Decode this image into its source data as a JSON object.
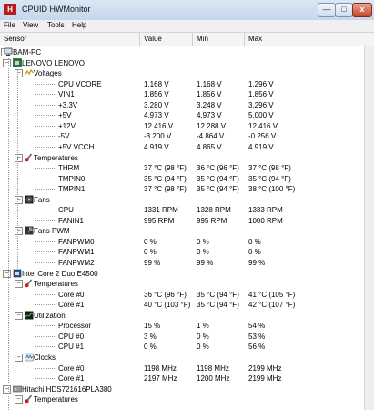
{
  "window": {
    "title": "CPUID HWMonitor",
    "icon_letter": "H",
    "accent": "#b71c1c",
    "minimize_glyph": "—",
    "maximize_glyph": "□",
    "close_glyph": "x"
  },
  "menu": [
    "File",
    "View",
    "Tools",
    "Help"
  ],
  "columns": {
    "sensor": "Sensor",
    "value": "Value",
    "min": "Min",
    "max": "Max"
  },
  "rows": [
    {
      "label": "BAM-PC",
      "icon": "computer-icon",
      "level": 0,
      "value": "",
      "min": "",
      "max": ""
    },
    {
      "label": "LENOVO LENOVO",
      "icon": "motherboard-icon",
      "level": 1,
      "value": "",
      "min": "",
      "max": ""
    },
    {
      "label": "Voltages",
      "icon": "voltage-icon",
      "level": 2,
      "value": "",
      "min": "",
      "max": ""
    },
    {
      "label": "CPU VCORE",
      "icon": "",
      "level": 3,
      "value": "1.168 V",
      "min": "1.168 V",
      "max": "1.296 V"
    },
    {
      "label": "VIN1",
      "icon": "",
      "level": 3,
      "value": "1.856 V",
      "min": "1.856 V",
      "max": "1.856 V"
    },
    {
      "label": "+3.3V",
      "icon": "",
      "level": 3,
      "value": "3.280 V",
      "min": "3.248 V",
      "max": "3.296 V"
    },
    {
      "label": "+5V",
      "icon": "",
      "level": 3,
      "value": "4.973 V",
      "min": "4.973 V",
      "max": "5.000 V"
    },
    {
      "label": "+12V",
      "icon": "",
      "level": 3,
      "value": "12.416 V",
      "min": "12.288 V",
      "max": "12.416 V"
    },
    {
      "label": "-5V",
      "icon": "",
      "level": 3,
      "value": "-3.200 V",
      "min": "-4.864 V",
      "max": "-0.256 V"
    },
    {
      "label": "+5V VCCH",
      "icon": "",
      "level": 3,
      "value": "4.919 V",
      "min": "4.865 V",
      "max": "4.919 V"
    },
    {
      "label": "Temperatures",
      "icon": "thermometer-icon",
      "level": 2,
      "value": "",
      "min": "",
      "max": ""
    },
    {
      "label": "THRM",
      "icon": "",
      "level": 3,
      "value": "37 °C  (98 °F)",
      "min": "36 °C  (96 °F)",
      "max": "37 °C  (98 °F)"
    },
    {
      "label": "TMPIN0",
      "icon": "",
      "level": 3,
      "value": "35 °C  (94 °F)",
      "min": "35 °C  (94 °F)",
      "max": "35 °C  (94 °F)"
    },
    {
      "label": "TMPIN1",
      "icon": "",
      "level": 3,
      "value": "37 °C  (98 °F)",
      "min": "35 °C  (94 °F)",
      "max": "38 °C  (100 °F)"
    },
    {
      "label": "Fans",
      "icon": "fan-icon",
      "level": 2,
      "value": "",
      "min": "",
      "max": ""
    },
    {
      "label": "CPU",
      "icon": "",
      "level": 3,
      "value": "1331 RPM",
      "min": "1328 RPM",
      "max": "1333 RPM"
    },
    {
      "label": "FANIN1",
      "icon": "",
      "level": 3,
      "value": "995 RPM",
      "min": "995 RPM",
      "max": "1000 RPM"
    },
    {
      "label": "Fans PWM",
      "icon": "fan-pwm-icon",
      "level": 2,
      "value": "",
      "min": "",
      "max": ""
    },
    {
      "label": "FANPWM0",
      "icon": "",
      "level": 3,
      "value": "0 %",
      "min": "0 %",
      "max": "0 %"
    },
    {
      "label": "FANPWM1",
      "icon": "",
      "level": 3,
      "value": "0 %",
      "min": "0 %",
      "max": "0 %"
    },
    {
      "label": "FANPWM2",
      "icon": "",
      "level": 3,
      "value": "99 %",
      "min": "99 %",
      "max": "99 %"
    },
    {
      "label": "Intel Core 2 Duo E4500",
      "icon": "cpu-icon",
      "level": 1,
      "value": "",
      "min": "",
      "max": ""
    },
    {
      "label": "Temperatures",
      "icon": "thermometer-icon",
      "level": 2,
      "value": "",
      "min": "",
      "max": ""
    },
    {
      "label": "Core #0",
      "icon": "",
      "level": 3,
      "value": "36 °C  (96 °F)",
      "min": "35 °C  (94 °F)",
      "max": "41 °C  (105 °F)"
    },
    {
      "label": "Core #1",
      "icon": "",
      "level": 3,
      "value": "40 °C  (103 °F)",
      "min": "35 °C  (94 °F)",
      "max": "42 °C  (107 °F)"
    },
    {
      "label": "Utilization",
      "icon": "utilization-icon",
      "level": 2,
      "value": "",
      "min": "",
      "max": ""
    },
    {
      "label": "Processor",
      "icon": "",
      "level": 3,
      "value": "15 %",
      "min": "1 %",
      "max": "54 %"
    },
    {
      "label": "CPU #0",
      "icon": "",
      "level": 3,
      "value": "3 %",
      "min": "0 %",
      "max": "53 %"
    },
    {
      "label": "CPU #1",
      "icon": "",
      "level": 3,
      "value": "0 %",
      "min": "0 %",
      "max": "56 %"
    },
    {
      "label": "Clocks",
      "icon": "clock-icon",
      "level": 2,
      "value": "",
      "min": "",
      "max": ""
    },
    {
      "label": "Core #0",
      "icon": "",
      "level": 3,
      "value": "1198 MHz",
      "min": "1198 MHz",
      "max": "2199 MHz"
    },
    {
      "label": "Core #1",
      "icon": "",
      "level": 3,
      "value": "2197 MHz",
      "min": "1200 MHz",
      "max": "2199 MHz"
    },
    {
      "label": "Hitachi HDS721616PLA380",
      "icon": "drive-icon",
      "level": 1,
      "value": "",
      "min": "",
      "max": ""
    },
    {
      "label": "Temperatures",
      "icon": "thermometer-icon",
      "level": 2,
      "value": "",
      "min": "",
      "max": ""
    }
  ]
}
